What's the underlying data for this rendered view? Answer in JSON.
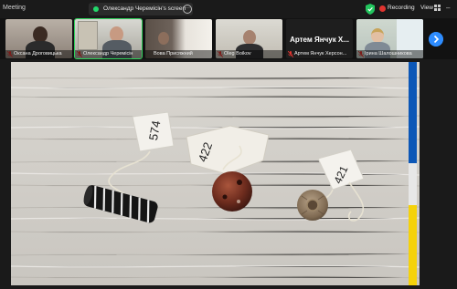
{
  "topbar": {
    "meeting_title": "Meeting",
    "share_label": "Олександр Черемісін's screen",
    "more": "···",
    "recording_label": "Recording",
    "view_label": "View"
  },
  "participants": [
    {
      "name": "Оксана Дроговицька"
    },
    {
      "name": "Олександр Черемісін"
    },
    {
      "name": "Вова Присяжний"
    },
    {
      "name": "Oleg Boikov"
    },
    {
      "name": "Артем Янчук Херсон...",
      "display_name": "Артем Янчук Х..."
    },
    {
      "name": "Ірина Шалошникова"
    }
  ],
  "tags": [
    {
      "label": "574"
    },
    {
      "label": "422"
    },
    {
      "label": "421"
    }
  ],
  "colors": {
    "accent_green": "#2fd15a",
    "recording_red": "#e0342f",
    "next_blue": "#2d8cff",
    "flag_blue": "#0c57b7",
    "flag_yellow": "#f5d20a"
  }
}
